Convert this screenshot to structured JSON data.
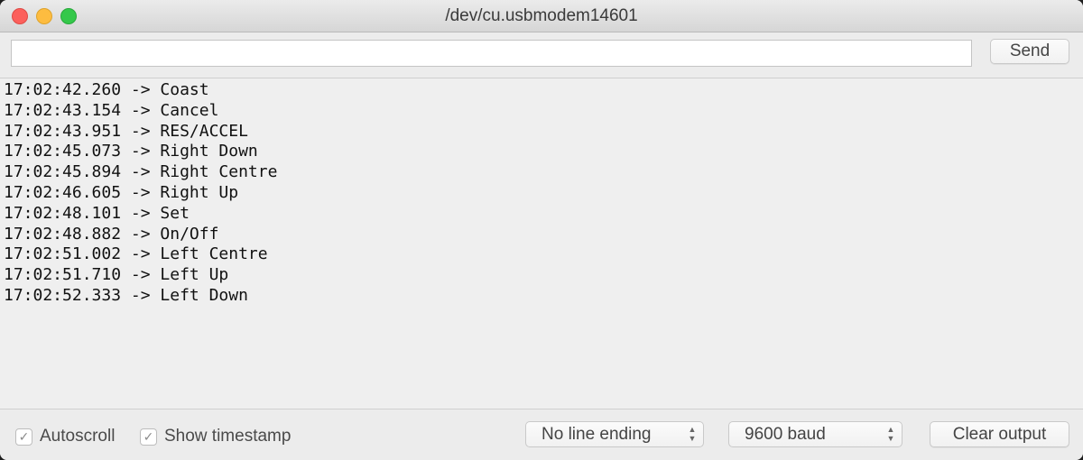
{
  "window": {
    "title": "/dev/cu.usbmodem14601"
  },
  "toolbar": {
    "input_value": "",
    "send_label": "Send"
  },
  "output": {
    "lines": [
      "17:02:42.260 -> Coast",
      "17:02:43.154 -> Cancel",
      "17:02:43.951 -> RES/ACCEL",
      "17:02:45.073 -> Right Down",
      "17:02:45.894 -> Right Centre",
      "17:02:46.605 -> Right Up",
      "17:02:48.101 -> Set",
      "17:02:48.882 -> On/Off",
      "17:02:51.002 -> Left Centre",
      "17:02:51.710 -> Left Up",
      "17:02:52.333 -> Left Down"
    ]
  },
  "footer": {
    "autoscroll_label": "Autoscroll",
    "autoscroll_checked": true,
    "timestamp_label": "Show timestamp",
    "timestamp_checked": true,
    "line_ending_value": "No line ending",
    "baud_value": "9600 baud",
    "clear_label": "Clear output"
  },
  "icons": {
    "checkmark": "check-icon",
    "select_arrows": "up-down-chevron-icon"
  },
  "colors": {
    "close": "#fc605c",
    "minimize": "#fdbc40",
    "maximize": "#34c84a",
    "window_bg": "#ececec",
    "output_bg": "#efefef"
  }
}
